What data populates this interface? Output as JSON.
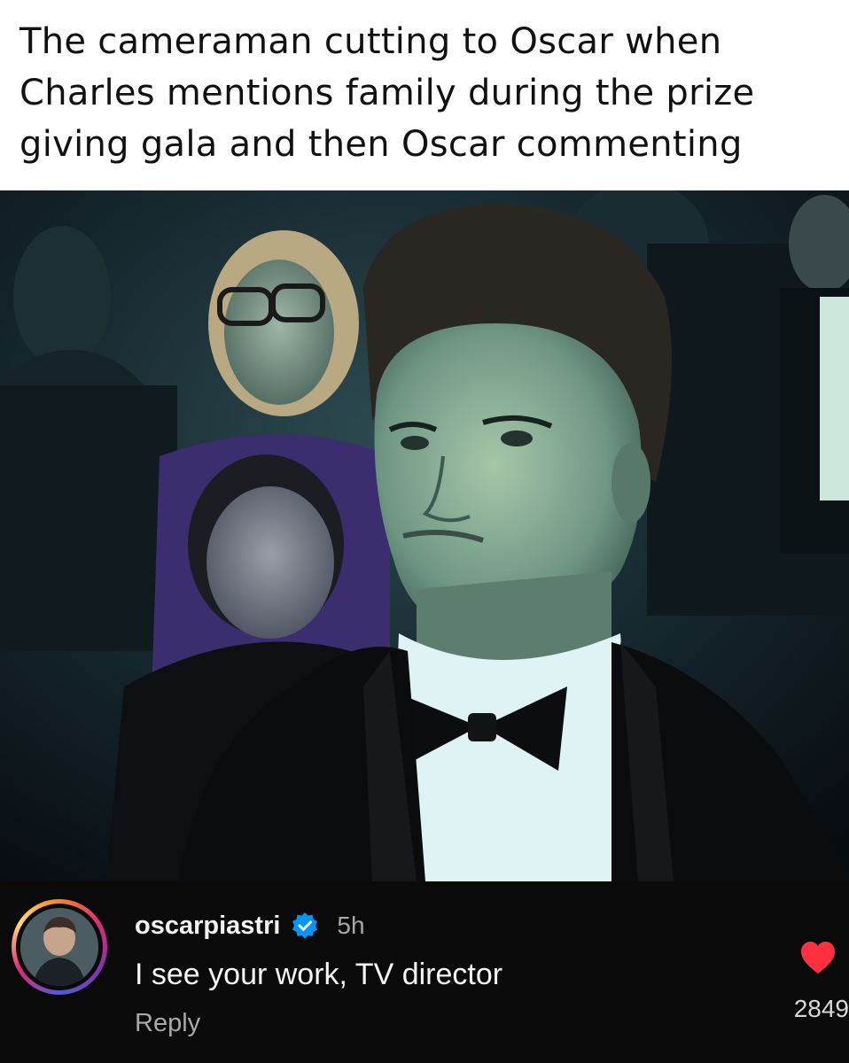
{
  "caption": {
    "line1": "The cameraman cutting to Oscar when",
    "line2": "Charles mentions family during the prize",
    "line3": "giving gala and then Oscar commenting"
  },
  "photo": {
    "subject": "young man in tuxedo and bow tie seated in audience at gala"
  },
  "comment": {
    "username": "oscarpiastri",
    "verified_icon": "verified-badge-icon",
    "time": "5h",
    "text": "I see your work, TV director",
    "reply_label": "Reply",
    "like_icon": "heart-icon",
    "like_count": "2849"
  },
  "colors": {
    "heart": "#ff3040",
    "verified": "#0095f6",
    "comment_bg": "#0a0a0a"
  }
}
